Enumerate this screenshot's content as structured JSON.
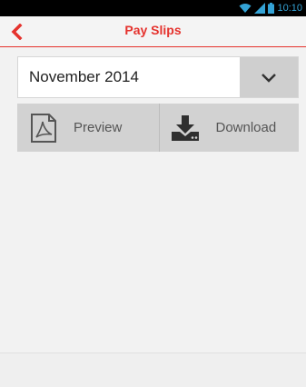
{
  "status_bar": {
    "time": "10:10",
    "wifi_icon": "wifi-icon",
    "signal_icon": "signal-icon",
    "battery_icon": "battery-icon"
  },
  "app_bar": {
    "title": "Pay Slips",
    "back_icon": "chevron-left-icon",
    "accent_color": "#e5322d"
  },
  "period_select": {
    "selected": "November 2014",
    "caret_icon": "chevron-down-icon"
  },
  "actions": {
    "preview_label": "Preview",
    "preview_icon": "pdf-icon",
    "download_label": "Download",
    "download_icon": "download-icon"
  }
}
